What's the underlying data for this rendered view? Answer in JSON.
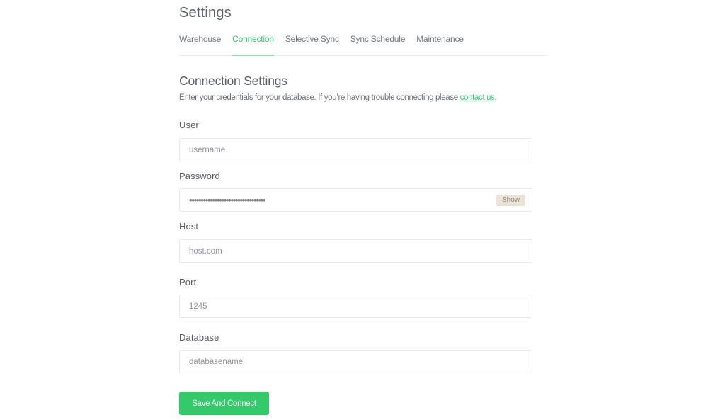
{
  "header": {
    "title": "Settings"
  },
  "tabs": [
    {
      "label": "Warehouse",
      "active": false
    },
    {
      "label": "Connection",
      "active": true
    },
    {
      "label": "Selective Sync",
      "active": false
    },
    {
      "label": "Sync Schedule",
      "active": false
    },
    {
      "label": "Maintenance",
      "active": false
    }
  ],
  "section": {
    "title": "Connection Settings",
    "description": "Enter your credentials for your database. If you’re having trouble connecting please ",
    "link_text": "contact us",
    "description_end": "."
  },
  "fields": {
    "user": {
      "label": "User",
      "placeholder": "username",
      "value": ""
    },
    "password": {
      "label": "Password",
      "masked_value": "•••••••••••••••••••••••••••••••••",
      "show_label": "Show"
    },
    "host": {
      "label": "Host",
      "placeholder": "host.com",
      "value": ""
    },
    "port": {
      "label": "Port",
      "placeholder": "1245",
      "value": ""
    },
    "database": {
      "label": "Database",
      "placeholder": "databasename",
      "value": ""
    }
  },
  "actions": {
    "save_label": "Save And Connect"
  },
  "colors": {
    "accent": "#34c96a",
    "tab_active": "#37c871",
    "show_button_bg": "#ebe3d7"
  }
}
